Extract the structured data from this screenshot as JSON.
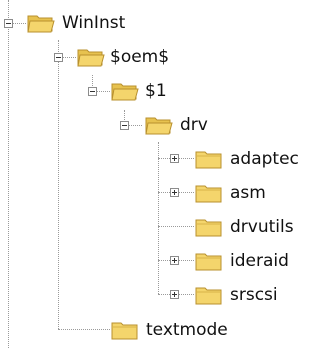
{
  "tree": {
    "nodes": [
      {
        "label": "WinInst",
        "state": "expanded"
      },
      {
        "label": "$oem$",
        "state": "expanded"
      },
      {
        "label": "$1",
        "state": "expanded"
      },
      {
        "label": "drv",
        "state": "expanded"
      },
      {
        "label": "adaptec",
        "state": "collapsed"
      },
      {
        "label": "asm",
        "state": "collapsed"
      },
      {
        "label": "drvutils",
        "state": "leaf"
      },
      {
        "label": "ideraid",
        "state": "collapsed"
      },
      {
        "label": "srscsi",
        "state": "collapsed"
      },
      {
        "label": "textmode",
        "state": "leaf"
      }
    ]
  },
  "colors": {
    "folder_fill": "#f4d56c",
    "folder_stroke": "#b8902e",
    "connector": "#9a9a9a"
  }
}
